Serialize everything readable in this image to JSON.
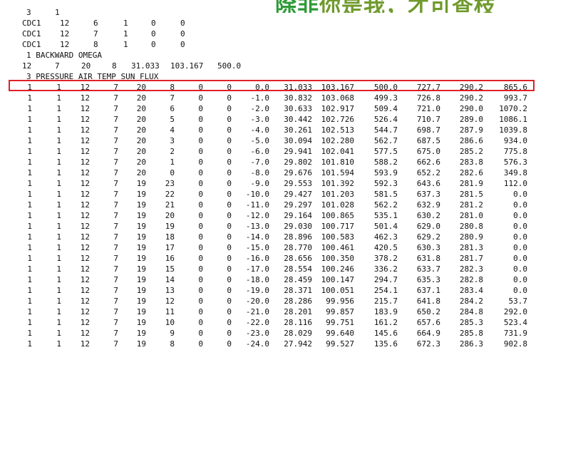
{
  "watermark": {
    "part1": "除非",
    "part2": "你是我，才可查枝",
    "color": "#2e9a37"
  },
  "header_lines": [
    [
      "3",
      "1"
    ],
    [
      "CDC1",
      "12",
      "6",
      "1",
      "0",
      "0"
    ],
    [
      "CDC1",
      "12",
      "7",
      "1",
      "0",
      "0"
    ],
    [
      "CDC1",
      "12",
      "8",
      "1",
      "0",
      "0"
    ],
    [
      "1 BACKWARD OMEGA"
    ],
    [
      "12",
      "7",
      "20",
      "8",
      "31.033",
      "103.167",
      "500.0"
    ],
    [
      "3 PRESSURE AIR TEMP SUN FLUX"
    ]
  ],
  "highlight_color": "#e0202a",
  "rows": [
    [
      "1",
      "1",
      "12",
      "7",
      "20",
      "8",
      "0",
      "0",
      "0.0",
      "31.033",
      "103.167",
      "500.0",
      "727.7",
      "290.2",
      "865.6"
    ],
    [
      "1",
      "1",
      "12",
      "7",
      "20",
      "7",
      "0",
      "0",
      "-1.0",
      "30.832",
      "103.068",
      "499.3",
      "726.8",
      "290.2",
      "993.7"
    ],
    [
      "1",
      "1",
      "12",
      "7",
      "20",
      "6",
      "0",
      "0",
      "-2.0",
      "30.633",
      "102.917",
      "509.4",
      "721.0",
      "290.0",
      "1070.2"
    ],
    [
      "1",
      "1",
      "12",
      "7",
      "20",
      "5",
      "0",
      "0",
      "-3.0",
      "30.442",
      "102.726",
      "526.4",
      "710.7",
      "289.0",
      "1086.1"
    ],
    [
      "1",
      "1",
      "12",
      "7",
      "20",
      "4",
      "0",
      "0",
      "-4.0",
      "30.261",
      "102.513",
      "544.7",
      "698.7",
      "287.9",
      "1039.8"
    ],
    [
      "1",
      "1",
      "12",
      "7",
      "20",
      "3",
      "0",
      "0",
      "-5.0",
      "30.094",
      "102.280",
      "562.7",
      "687.5",
      "286.6",
      "934.0"
    ],
    [
      "1",
      "1",
      "12",
      "7",
      "20",
      "2",
      "0",
      "0",
      "-6.0",
      "29.941",
      "102.041",
      "577.5",
      "675.0",
      "285.2",
      "775.8"
    ],
    [
      "1",
      "1",
      "12",
      "7",
      "20",
      "1",
      "0",
      "0",
      "-7.0",
      "29.802",
      "101.810",
      "588.2",
      "662.6",
      "283.8",
      "576.3"
    ],
    [
      "1",
      "1",
      "12",
      "7",
      "20",
      "0",
      "0",
      "0",
      "-8.0",
      "29.676",
      "101.594",
      "593.9",
      "652.2",
      "282.6",
      "349.8"
    ],
    [
      "1",
      "1",
      "12",
      "7",
      "19",
      "23",
      "0",
      "0",
      "-9.0",
      "29.553",
      "101.392",
      "592.3",
      "643.6",
      "281.9",
      "112.0"
    ],
    [
      "1",
      "1",
      "12",
      "7",
      "19",
      "22",
      "0",
      "0",
      "-10.0",
      "29.427",
      "101.203",
      "581.5",
      "637.3",
      "281.5",
      "0.0"
    ],
    [
      "1",
      "1",
      "12",
      "7",
      "19",
      "21",
      "0",
      "0",
      "-11.0",
      "29.297",
      "101.028",
      "562.2",
      "632.9",
      "281.2",
      "0.0"
    ],
    [
      "1",
      "1",
      "12",
      "7",
      "19",
      "20",
      "0",
      "0",
      "-12.0",
      "29.164",
      "100.865",
      "535.1",
      "630.2",
      "281.0",
      "0.0"
    ],
    [
      "1",
      "1",
      "12",
      "7",
      "19",
      "19",
      "0",
      "0",
      "-13.0",
      "29.030",
      "100.717",
      "501.4",
      "629.0",
      "280.8",
      "0.0"
    ],
    [
      "1",
      "1",
      "12",
      "7",
      "19",
      "18",
      "0",
      "0",
      "-14.0",
      "28.896",
      "100.583",
      "462.3",
      "629.2",
      "280.9",
      "0.0"
    ],
    [
      "1",
      "1",
      "12",
      "7",
      "19",
      "17",
      "0",
      "0",
      "-15.0",
      "28.770",
      "100.461",
      "420.5",
      "630.3",
      "281.3",
      "0.0"
    ],
    [
      "1",
      "1",
      "12",
      "7",
      "19",
      "16",
      "0",
      "0",
      "-16.0",
      "28.656",
      "100.350",
      "378.2",
      "631.8",
      "281.7",
      "0.0"
    ],
    [
      "1",
      "1",
      "12",
      "7",
      "19",
      "15",
      "0",
      "0",
      "-17.0",
      "28.554",
      "100.246",
      "336.2",
      "633.7",
      "282.3",
      "0.0"
    ],
    [
      "1",
      "1",
      "12",
      "7",
      "19",
      "14",
      "0",
      "0",
      "-18.0",
      "28.459",
      "100.147",
      "294.7",
      "635.3",
      "282.8",
      "0.0"
    ],
    [
      "1",
      "1",
      "12",
      "7",
      "19",
      "13",
      "0",
      "0",
      "-19.0",
      "28.371",
      "100.051",
      "254.1",
      "637.1",
      "283.4",
      "0.0"
    ],
    [
      "1",
      "1",
      "12",
      "7",
      "19",
      "12",
      "0",
      "0",
      "-20.0",
      "28.286",
      "99.956",
      "215.7",
      "641.8",
      "284.2",
      "53.7"
    ],
    [
      "1",
      "1",
      "12",
      "7",
      "19",
      "11",
      "0",
      "0",
      "-21.0",
      "28.201",
      "99.857",
      "183.9",
      "650.2",
      "284.8",
      "292.0"
    ],
    [
      "1",
      "1",
      "12",
      "7",
      "19",
      "10",
      "0",
      "0",
      "-22.0",
      "28.116",
      "99.751",
      "161.2",
      "657.6",
      "285.3",
      "523.4"
    ],
    [
      "1",
      "1",
      "12",
      "7",
      "19",
      "9",
      "0",
      "0",
      "-23.0",
      "28.029",
      "99.640",
      "145.6",
      "664.9",
      "285.8",
      "731.9"
    ],
    [
      "1",
      "1",
      "12",
      "7",
      "19",
      "8",
      "0",
      "0",
      "-24.0",
      "27.942",
      "99.527",
      "135.6",
      "672.3",
      "286.3",
      "902.8"
    ]
  ]
}
